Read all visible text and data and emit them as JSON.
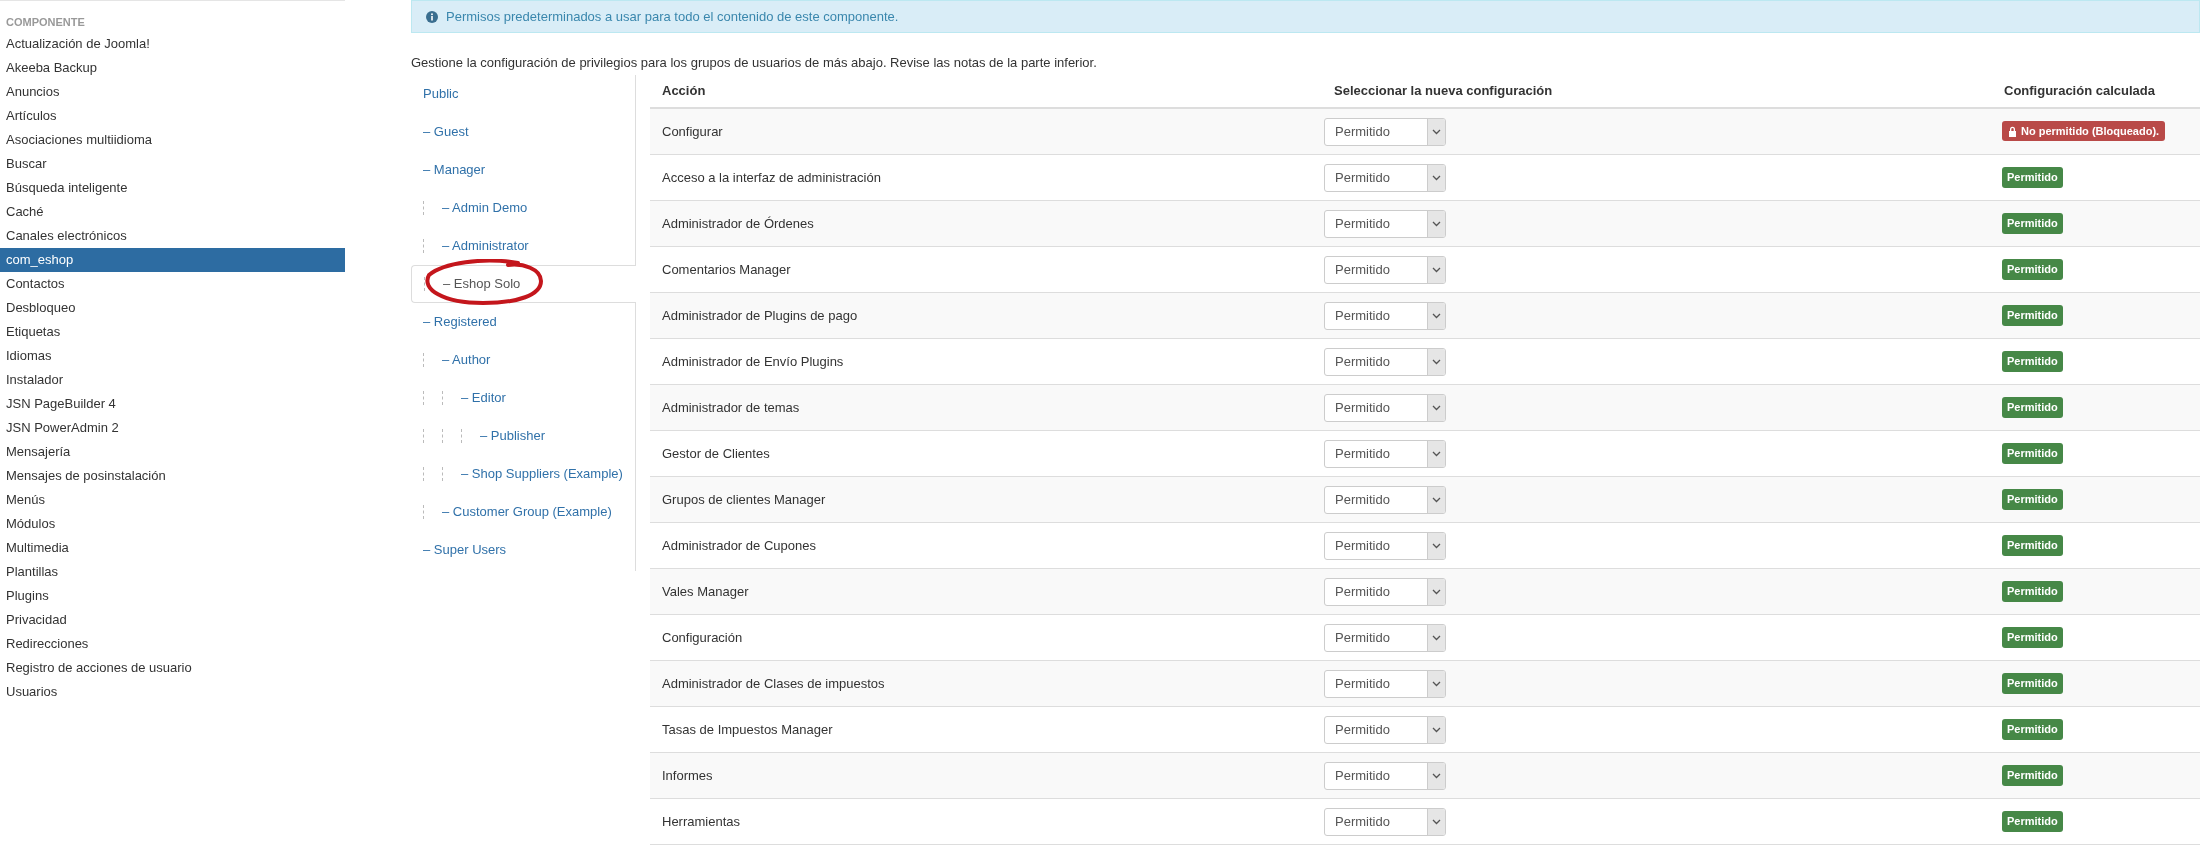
{
  "sidebar": {
    "heading": "COMPONENTE",
    "items": [
      {
        "label": "Actualización de Joomla!",
        "selected": false
      },
      {
        "label": "Akeeba Backup",
        "selected": false
      },
      {
        "label": "Anuncios",
        "selected": false
      },
      {
        "label": "Artículos",
        "selected": false
      },
      {
        "label": "Asociaciones multiidioma",
        "selected": false
      },
      {
        "label": "Buscar",
        "selected": false
      },
      {
        "label": "Búsqueda inteligente",
        "selected": false
      },
      {
        "label": "Caché",
        "selected": false
      },
      {
        "label": "Canales electrónicos",
        "selected": false
      },
      {
        "label": "com_eshop",
        "selected": true
      },
      {
        "label": "Contactos",
        "selected": false
      },
      {
        "label": "Desbloqueo",
        "selected": false
      },
      {
        "label": "Etiquetas",
        "selected": false
      },
      {
        "label": "Idiomas",
        "selected": false
      },
      {
        "label": "Instalador",
        "selected": false
      },
      {
        "label": "JSN PageBuilder 4",
        "selected": false
      },
      {
        "label": "JSN PowerAdmin 2",
        "selected": false
      },
      {
        "label": "Mensajería",
        "selected": false
      },
      {
        "label": "Mensajes de posinstalación",
        "selected": false
      },
      {
        "label": "Menús",
        "selected": false
      },
      {
        "label": "Módulos",
        "selected": false
      },
      {
        "label": "Multimedia",
        "selected": false
      },
      {
        "label": "Plantillas",
        "selected": false
      },
      {
        "label": "Plugins",
        "selected": false
      },
      {
        "label": "Privacidad",
        "selected": false
      },
      {
        "label": "Redirecciones",
        "selected": false
      },
      {
        "label": "Registro de acciones de usuario",
        "selected": false
      },
      {
        "label": "Usuarios",
        "selected": false
      }
    ]
  },
  "info": "Permisos predeterminados a usar para todo el contenido de este componente.",
  "description": "Gestione la configuración de privilegios para los grupos de usuarios de más abajo. Revise las notas de la parte inferior.",
  "groups": [
    {
      "label": "Public",
      "selected": false,
      "children": [
        {
          "label": "– Guest",
          "selected": false
        },
        {
          "label": "– Manager",
          "selected": false,
          "children": [
            {
              "label": "– Admin Demo",
              "selected": false
            },
            {
              "label": "– Administrator",
              "selected": false
            },
            {
              "label": "– Eshop Solo",
              "selected": true,
              "circled": true
            }
          ]
        },
        {
          "label": "– Registered",
          "selected": false,
          "children": [
            {
              "label": "– Author",
              "selected": false,
              "children": [
                {
                  "label": "– Editor",
                  "selected": false,
                  "children": [
                    {
                      "label": "– Publisher",
                      "selected": false
                    }
                  ]
                },
                {
                  "label": "– Shop Suppliers (Example)",
                  "selected": false
                }
              ]
            },
            {
              "label": "– Customer Group (Example)",
              "selected": false
            }
          ]
        },
        {
          "label": "– Super Users",
          "selected": false
        }
      ]
    }
  ],
  "table": {
    "columns": [
      "Acción",
      "Seleccionar la nueva configuración",
      "Configuración calculada"
    ],
    "rows": [
      {
        "action": "Configurar",
        "setting": "Permitido",
        "calculated": {
          "text": "No permitido (Bloqueado).",
          "kind": "locked"
        }
      },
      {
        "action": "Acceso a la interfaz de administración",
        "setting": "Permitido",
        "calculated": {
          "text": "Permitido",
          "kind": "allowed"
        }
      },
      {
        "action": "Administrador de Órdenes",
        "setting": "Permitido",
        "calculated": {
          "text": "Permitido",
          "kind": "allowed"
        }
      },
      {
        "action": "Comentarios Manager",
        "setting": "Permitido",
        "calculated": {
          "text": "Permitido",
          "kind": "allowed"
        }
      },
      {
        "action": "Administrador de Plugins de pago",
        "setting": "Permitido",
        "calculated": {
          "text": "Permitido",
          "kind": "allowed"
        }
      },
      {
        "action": "Administrador de Envío Plugins",
        "setting": "Permitido",
        "calculated": {
          "text": "Permitido",
          "kind": "allowed"
        }
      },
      {
        "action": "Administrador de temas",
        "setting": "Permitido",
        "calculated": {
          "text": "Permitido",
          "kind": "allowed"
        }
      },
      {
        "action": "Gestor de Clientes",
        "setting": "Permitido",
        "calculated": {
          "text": "Permitido",
          "kind": "allowed"
        }
      },
      {
        "action": "Grupos de clientes Manager",
        "setting": "Permitido",
        "calculated": {
          "text": "Permitido",
          "kind": "allowed"
        }
      },
      {
        "action": "Administrador de Cupones",
        "setting": "Permitido",
        "calculated": {
          "text": "Permitido",
          "kind": "allowed"
        }
      },
      {
        "action": "Vales Manager",
        "setting": "Permitido",
        "calculated": {
          "text": "Permitido",
          "kind": "allowed"
        }
      },
      {
        "action": "Configuración",
        "setting": "Permitido",
        "calculated": {
          "text": "Permitido",
          "kind": "allowed"
        }
      },
      {
        "action": "Administrador de Clases de impuestos",
        "setting": "Permitido",
        "calculated": {
          "text": "Permitido",
          "kind": "allowed"
        }
      },
      {
        "action": "Tasas de Impuestos Manager",
        "setting": "Permitido",
        "calculated": {
          "text": "Permitido",
          "kind": "allowed"
        }
      },
      {
        "action": "Informes",
        "setting": "Permitido",
        "calculated": {
          "text": "Permitido",
          "kind": "allowed"
        }
      },
      {
        "action": "Herramientas",
        "setting": "Permitido",
        "calculated": {
          "text": "Permitido",
          "kind": "allowed"
        }
      }
    ]
  }
}
